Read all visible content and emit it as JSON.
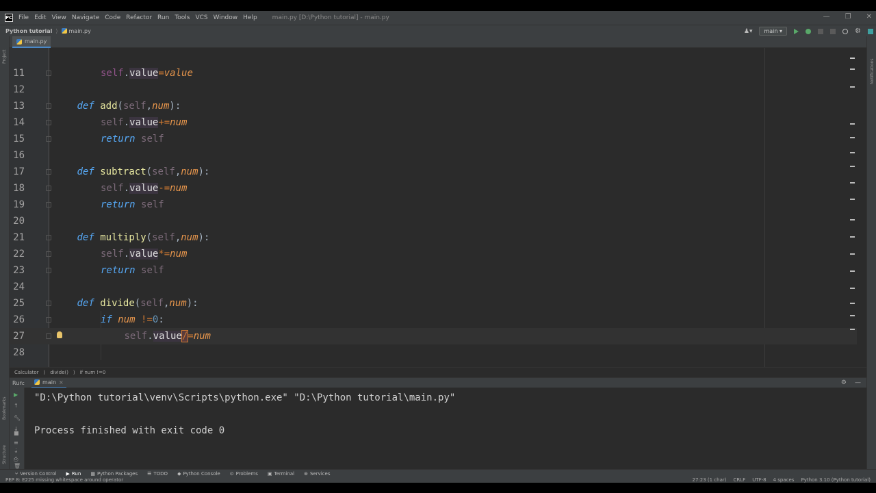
{
  "window": {
    "app_logo": "PC",
    "title": "main.py [D:\\Python tutorial] - main.py",
    "menu": [
      "File",
      "Edit",
      "View",
      "Navigate",
      "Code",
      "Refactor",
      "Run",
      "Tools",
      "VCS",
      "Window",
      "Help"
    ]
  },
  "navbar": {
    "project": "Python tutorial",
    "file": "main.py",
    "run_config": "main ▾"
  },
  "editor": {
    "tab_label": "main.py",
    "lines": [
      {
        "n": "11",
        "indent": 2,
        "tokens": [
          [
            "self",
            "slf"
          ],
          [
            ".",
            "pun"
          ],
          [
            "value",
            "fld"
          ],
          [
            "=",
            "op"
          ],
          [
            "value",
            "par"
          ]
        ]
      },
      {
        "n": "12",
        "indent": 0,
        "tokens": []
      },
      {
        "n": "13",
        "indent": 1,
        "tokens": [
          [
            "def ",
            "def"
          ],
          [
            "add",
            "fn"
          ],
          [
            "(",
            "pun"
          ],
          [
            "self",
            "dim"
          ],
          [
            ",",
            "pun"
          ],
          [
            "num",
            "par"
          ],
          [
            "):",
            "pun"
          ]
        ]
      },
      {
        "n": "14",
        "indent": 2,
        "tokens": [
          [
            "self",
            "dim"
          ],
          [
            ".",
            "pun"
          ],
          [
            "value",
            "fld"
          ],
          [
            "+=",
            "op"
          ],
          [
            "num",
            "par"
          ]
        ]
      },
      {
        "n": "15",
        "indent": 2,
        "tokens": [
          [
            "return ",
            "ret"
          ],
          [
            "self",
            "dim"
          ]
        ]
      },
      {
        "n": "16",
        "indent": 0,
        "tokens": []
      },
      {
        "n": "17",
        "indent": 1,
        "tokens": [
          [
            "def ",
            "def"
          ],
          [
            "subtract",
            "fn"
          ],
          [
            "(",
            "pun"
          ],
          [
            "self",
            "dim"
          ],
          [
            ",",
            "pun"
          ],
          [
            "num",
            "par"
          ],
          [
            "):",
            "pun"
          ]
        ]
      },
      {
        "n": "18",
        "indent": 2,
        "tokens": [
          [
            "self",
            "dim"
          ],
          [
            ".",
            "pun"
          ],
          [
            "value",
            "fld"
          ],
          [
            "-=",
            "op"
          ],
          [
            "num",
            "par"
          ]
        ]
      },
      {
        "n": "19",
        "indent": 2,
        "tokens": [
          [
            "return ",
            "ret"
          ],
          [
            "self",
            "dim"
          ]
        ]
      },
      {
        "n": "20",
        "indent": 0,
        "tokens": []
      },
      {
        "n": "21",
        "indent": 1,
        "tokens": [
          [
            "def ",
            "def"
          ],
          [
            "multiply",
            "fn"
          ],
          [
            "(",
            "pun"
          ],
          [
            "self",
            "dim"
          ],
          [
            ",",
            "pun"
          ],
          [
            "num",
            "par"
          ],
          [
            "):",
            "pun"
          ]
        ]
      },
      {
        "n": "22",
        "indent": 2,
        "tokens": [
          [
            "self",
            "dim"
          ],
          [
            ".",
            "pun"
          ],
          [
            "value",
            "fld"
          ],
          [
            "*=",
            "op"
          ],
          [
            "num",
            "par"
          ]
        ]
      },
      {
        "n": "23",
        "indent": 2,
        "tokens": [
          [
            "return ",
            "ret"
          ],
          [
            "self",
            "dim"
          ]
        ]
      },
      {
        "n": "24",
        "indent": 0,
        "tokens": []
      },
      {
        "n": "25",
        "indent": 1,
        "tokens": [
          [
            "def ",
            "def"
          ],
          [
            "divide",
            "fn"
          ],
          [
            "(",
            "pun"
          ],
          [
            "self",
            "dim"
          ],
          [
            ",",
            "pun"
          ],
          [
            "num",
            "par"
          ],
          [
            "):",
            "pun"
          ]
        ]
      },
      {
        "n": "26",
        "indent": 2,
        "tokens": [
          [
            "if ",
            "ret"
          ],
          [
            "num",
            "par"
          ],
          [
            " !=",
            "op"
          ],
          [
            "0",
            "num"
          ],
          [
            ":",
            "pun"
          ]
        ]
      },
      {
        "n": "27",
        "indent": 3,
        "current": true,
        "tokens": [
          [
            "self",
            "dim"
          ],
          [
            ".",
            "pun"
          ],
          [
            "value",
            "fld"
          ],
          [
            "/",
            "cursor"
          ],
          [
            "=",
            "op"
          ],
          [
            "num",
            "par"
          ]
        ]
      },
      {
        "n": "28",
        "indent": 0,
        "tokens": []
      }
    ]
  },
  "breadcrumb": [
    "Calculator",
    "divide()",
    "if num !=0"
  ],
  "run_panel": {
    "title": "Run:",
    "tab": "main",
    "output": [
      "\"D:\\Python tutorial\\venv\\Scripts\\python.exe\" \"D:\\Python tutorial\\main.py\"",
      "",
      "Process finished with exit code 0"
    ]
  },
  "tool_windows": [
    {
      "label": "Version Control",
      "icon": "branch-icon"
    },
    {
      "label": "Run",
      "icon": "play-icon",
      "active": true
    },
    {
      "label": "Python Packages",
      "icon": "packages-icon"
    },
    {
      "label": "TODO",
      "icon": "list-icon"
    },
    {
      "label": "Python Console",
      "icon": "console-icon"
    },
    {
      "label": "Problems",
      "icon": "problems-icon"
    },
    {
      "label": "Terminal",
      "icon": "terminal-icon"
    },
    {
      "label": "Services",
      "icon": "services-icon"
    }
  ],
  "status": {
    "message": "PEP 8: E225 missing whitespace around operator",
    "position": "27:23 (1 char)",
    "line_sep": "CRLF",
    "encoding": "UTF-8",
    "indent": "4 spaces",
    "interpreter": "Python 3.10 (Python tutorial)"
  },
  "stripes": {
    "left": [
      "Project",
      "Bookmarks",
      "Structure"
    ],
    "right": [
      "Notifications"
    ]
  }
}
